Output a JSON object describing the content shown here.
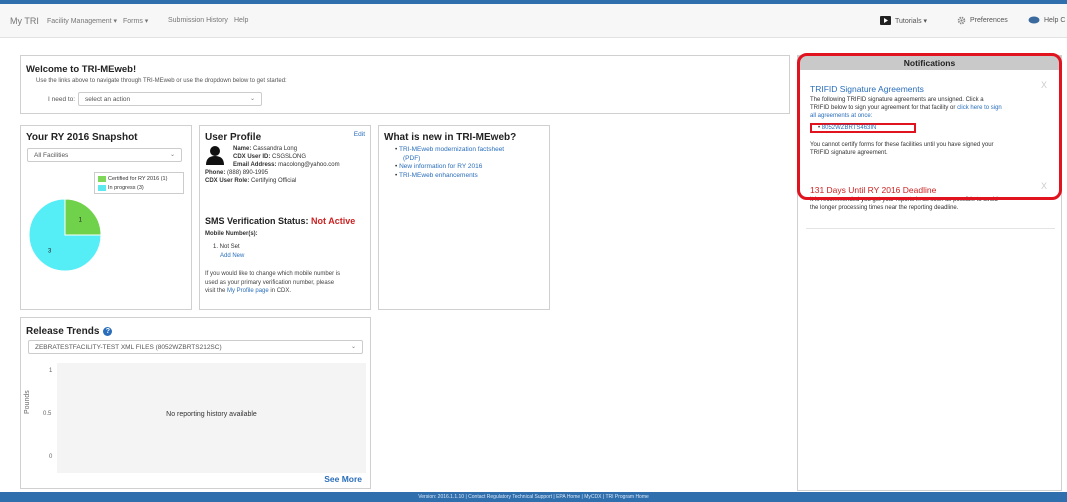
{
  "nav": {
    "brand": "My TRI",
    "items": [
      "Facility Management ▾",
      "Forms ▾",
      "Submission History",
      "Help"
    ],
    "right": {
      "tutorials": "Tutorials ▾",
      "preferences": "Preferences",
      "help": "Help C"
    }
  },
  "welcome": {
    "title": "Welcome to TRI-MEweb!",
    "subtitle": "Use the links above to navigate through TRI-MEweb or use the dropdown below to get started:",
    "need_label": "I need to:",
    "select_placeholder": "select an action"
  },
  "snapshot": {
    "title": "Your RY 2016 Snapshot",
    "filter": "All Facilities",
    "legend": [
      {
        "label": "Certified for RY 2016 (1)",
        "color": "#7fd85a"
      },
      {
        "label": "In progress (3)",
        "color": "#5ee8f0"
      }
    ]
  },
  "chart_data": {
    "type": "pie",
    "categories": [
      "Certified for RY 2016",
      "In progress"
    ],
    "values": [
      1,
      3
    ],
    "labels": [
      "1",
      "3"
    ],
    "colors": [
      "#6fd24a",
      "#55eef7"
    ]
  },
  "profile": {
    "title": "User Profile",
    "edit": "Edit",
    "name_label": "Name:",
    "name": "Cassandra Long",
    "cdx_label": "CDX User ID:",
    "cdx": "CSGSLONG",
    "email_label": "Email Address:",
    "email": "macolong@yahoo.com",
    "phone_label": "Phone:",
    "phone": "(888) 890-1995",
    "role_label": "CDX User Role:",
    "role": "Certifying Official",
    "sms_title": "SMS Verification Status:",
    "sms_status": "Not Active",
    "mobile_label": "Mobile Number(s):",
    "mobile_item": "1. Not Set",
    "add_new": "Add New",
    "note_1": "If you would like to change which mobile number is",
    "note_2": "used as your primary verification number, please",
    "note_3_pre": "visit the",
    "note_link": "My Profile page",
    "note_3_post": "in CDX."
  },
  "whatsnew": {
    "title": "What is new in TRI-MEweb?",
    "items": [
      "TRI-MEweb modernization factsheet",
      "(PDF)",
      "New information for RY 2016",
      "TRI-MEweb enhancements"
    ]
  },
  "trends": {
    "title": "Release Trends",
    "facility": "ZEBRATESTFACILITY-TEST XML FILES (8052WZBRTS212SC)",
    "y_ticks": [
      "1",
      "0.5",
      "0"
    ],
    "y_label": "Pounds",
    "empty": "No reporting history available",
    "see_more": "See More"
  },
  "notifications": {
    "header": "Notifications",
    "sig_title": "TRIFID Signature Agreements",
    "sig_text_1": "The following TRIFID signature agreements are unsigned. Click a",
    "sig_text_2": "TRIFID below to sign your agreement for that facility or",
    "sig_link_1": "click here to sign",
    "sig_link_2": "all agreements at once:",
    "trifid": "8052WZBRTS463IN",
    "sig_note_1": "You cannot certify forms for these facilities until you have signed your",
    "sig_note_2": "TRIFID signature agreement.",
    "deadline_title": "131 Days Until RY 2016 Deadline",
    "deadline_text_1": "It is recommended you get your reports in as soon as possible to avoid",
    "deadline_text_2": "the longer processing times near the reporting deadline.",
    "close": "X"
  },
  "footer": "Version: 2016.1.1.10 | Contact Regulatory Technical Support | EPA Home | MyCDX | TRI Program Home",
  "colors": {
    "accent": "#2a6ebb",
    "danger": "#cc2222",
    "highlight": "#e0131f",
    "footer": "#2f6fae"
  }
}
